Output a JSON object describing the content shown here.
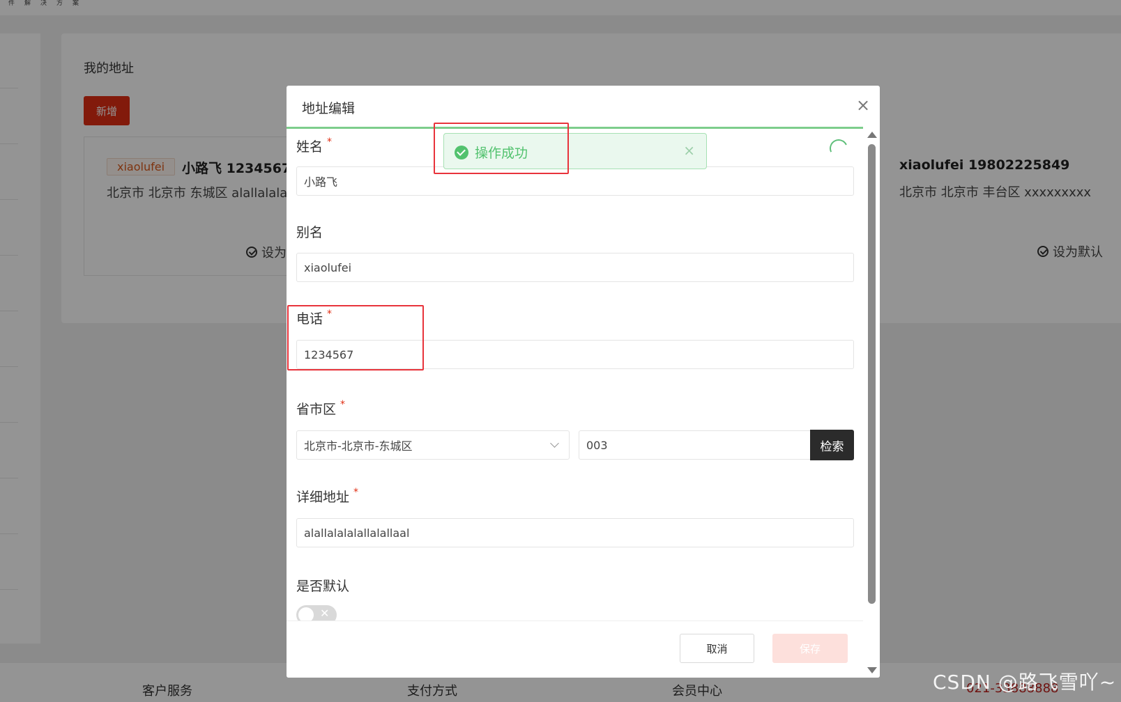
{
  "header": {
    "brand": "件解决方案"
  },
  "page": {
    "title": "我的地址",
    "add_button": "新增"
  },
  "address_cards": [
    {
      "alias": "xiaolufei",
      "name_phone": "小路飞 1234567",
      "address": "北京市 北京市 东城区 alallalala",
      "default_label": "设为"
    },
    {
      "name_phone": "xiaolufei 19802225849",
      "address": "北京市 北京市 丰台区 xxxxxxxxx",
      "default_label": "设为默认"
    }
  ],
  "footer": {
    "links": [
      "客户服务",
      "支付方式",
      "会员中心"
    ],
    "phone": "021-33888888"
  },
  "watermark": "CSDN @路飞雪吖~",
  "dialog": {
    "title": "地址编辑",
    "close_icon": "×",
    "fields": {
      "name": {
        "label": "姓名",
        "required": "*",
        "value": "小路飞"
      },
      "alias": {
        "label": "别名",
        "value": "xiaolufei"
      },
      "phone": {
        "label": "电话",
        "required": "*",
        "value": "1234567"
      },
      "region": {
        "label": "省市区",
        "required": "*",
        "selected": "北京市-北京市-东城区",
        "code": "003",
        "search_button": "检索"
      },
      "detail": {
        "label": "详细地址",
        "required": "*",
        "value": "alallalalalallalallaal"
      },
      "is_default": {
        "label": "是否默认",
        "value": false
      }
    },
    "cancel_button": "取消",
    "save_button": "保存"
  },
  "toast": {
    "message": "操作成功",
    "type": "success",
    "close_icon": "×"
  },
  "colors": {
    "brand_red": "#e02e14",
    "success_green": "#52c26e",
    "highlight_red": "#e8333b"
  }
}
